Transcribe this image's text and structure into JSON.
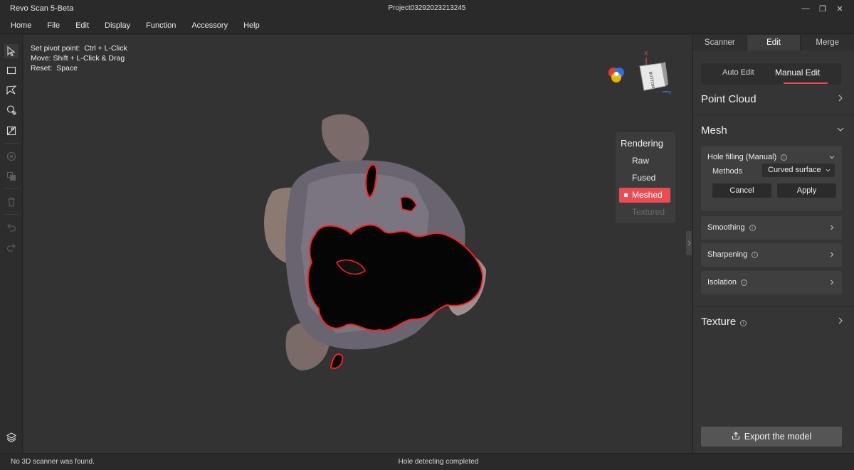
{
  "window": {
    "app_title": "Revo Scan 5-Beta",
    "project_title": "Project03292023213245",
    "minimize_glyph": "—",
    "maximize_glyph": "❐",
    "close_glyph": "✕"
  },
  "menu": [
    "Home",
    "File",
    "Edit",
    "Display",
    "Function",
    "Accessory",
    "Help"
  ],
  "toolbar_icons": [
    "select-arrow-icon",
    "rectangle-select-icon",
    "lasso-select-icon",
    "brush-select-icon",
    "invert-select-icon",
    "hide-icon",
    "isolate-icon",
    "delete-icon",
    "undo-icon",
    "redo-icon",
    "layers-icon"
  ],
  "hints": [
    {
      "label": "Set pivot point:",
      "value": "Ctrl + L-Click"
    },
    {
      "label": "Move:",
      "value": "Shift + L-Click & Drag"
    },
    {
      "label": "Reset:",
      "value": "Space"
    }
  ],
  "orientation": {
    "face_label": "BOTTOM",
    "x_axis": "X",
    "y_axis": "Y"
  },
  "rendering": {
    "title": "Rendering",
    "options": [
      {
        "label": "Raw",
        "state": "normal"
      },
      {
        "label": "Fused",
        "state": "normal"
      },
      {
        "label": "Meshed",
        "state": "selected"
      },
      {
        "label": "Textured",
        "state": "disabled"
      }
    ]
  },
  "right_panel": {
    "tabs": [
      {
        "label": "Scanner",
        "active": false
      },
      {
        "label": "Edit",
        "active": true
      },
      {
        "label": "Merge",
        "active": false
      }
    ],
    "subtabs": {
      "auto": "Auto Edit",
      "manual": "Manual Edit"
    },
    "sections": {
      "point_cloud": "Point Cloud",
      "mesh": "Mesh",
      "texture": "Texture"
    },
    "hole_filling": {
      "title": "Hole filling (Manual)",
      "methods_label": "Methods",
      "methods_value": "Curved surface",
      "cancel": "Cancel",
      "apply": "Apply"
    },
    "mesh_tools": [
      "Smoothing",
      "Sharpening",
      "Isolation"
    ],
    "export_label": "Export the model"
  },
  "status": {
    "left": "No 3D scanner was found.",
    "center": "Hole detecting completed"
  },
  "colors": {
    "accent": "#ea4c54",
    "hole_outline": "#ff1e1e"
  }
}
